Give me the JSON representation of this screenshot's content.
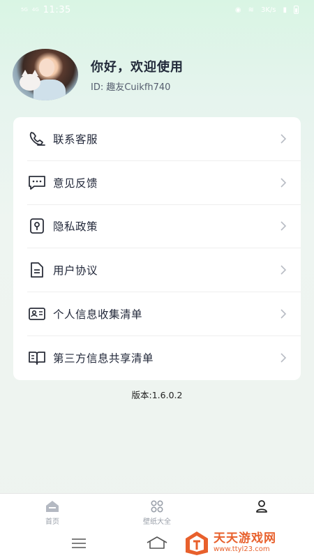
{
  "status_bar": {
    "network_left": "5G",
    "network_right": "4G",
    "time": "11:35",
    "right_info": "3K/s"
  },
  "profile": {
    "greeting": "你好，欢迎使用",
    "user_id": "ID: 趣友Cuikfh740"
  },
  "menu": {
    "items": [
      {
        "label": "联系客服",
        "icon": "phone-icon"
      },
      {
        "label": "意见反馈",
        "icon": "chat-bubble-icon"
      },
      {
        "label": "隐私政策",
        "icon": "lock-icon"
      },
      {
        "label": "用户协议",
        "icon": "document-icon"
      },
      {
        "label": "个人信息收集清单",
        "icon": "id-card-icon"
      },
      {
        "label": "第三方信息共享清单",
        "icon": "open-book-icon"
      }
    ]
  },
  "version": "版本:1.6.0.2",
  "bottom_nav": {
    "items": [
      {
        "label": "首页",
        "icon": "home-icon"
      },
      {
        "label": "壁纸大全",
        "icon": "grid-icon"
      },
      {
        "label": "",
        "icon": "user-icon"
      }
    ]
  },
  "watermark": {
    "title": "天天游戏网",
    "url": "www.ttyl23.com"
  },
  "colors": {
    "accent": "#e8602c",
    "card_bg": "#ffffff",
    "text": "#22283a"
  }
}
